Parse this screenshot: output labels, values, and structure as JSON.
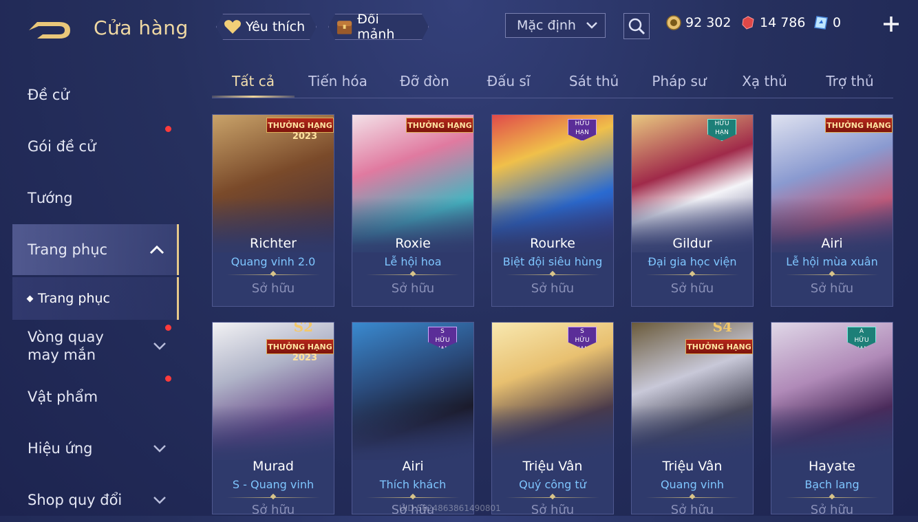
{
  "header": {
    "title": "Cửa hàng",
    "favorite_label": "Yêu thích",
    "shard_label": "Đổi mảnh",
    "sort_selected": "Mặc định",
    "currency": {
      "gold": "92 302",
      "ruby": "14 786",
      "voucher": "0"
    }
  },
  "sidebar": {
    "items": [
      {
        "label": "Đề cử"
      },
      {
        "label": "Gói đề cử"
      },
      {
        "label": "Tướng"
      },
      {
        "label": "Trang phục"
      },
      {
        "label": "Trang phục"
      },
      {
        "label": "Vòng quay may mắn"
      },
      {
        "label": "Vật phẩm"
      },
      {
        "label": "Hiệu ứng"
      },
      {
        "label": "Shop quy đổi"
      }
    ]
  },
  "tabs": [
    "Tất cả",
    "Tiến hóa",
    "Đỡ đòn",
    "Đấu sĩ",
    "Sát thủ",
    "Pháp sư",
    "Xạ thủ",
    "Trợ thủ"
  ],
  "cards": [
    {
      "hero": "Richter",
      "skin": "Quang vinh 2.0",
      "status": "Sở hữu",
      "badge": "THƯỞNG HẠNG",
      "year": "2023"
    },
    {
      "hero": "Roxie",
      "skin": "Lễ hội hoa",
      "status": "Sở hữu",
      "badge": "THƯỞNG HẠNG"
    },
    {
      "hero": "Rourke",
      "skin": "Biệt đội siêu hùng",
      "status": "Sở hữu",
      "badge": "HỮU HẠN"
    },
    {
      "hero": "Gildur",
      "skin": "Đại gia học viện",
      "status": "Sở hữu",
      "badge": "HỮU HẠN"
    },
    {
      "hero": "Airi",
      "skin": "Lễ hội mùa xuân",
      "status": "Sở hữu",
      "badge": "THƯỞNG HẠNG"
    },
    {
      "hero": "Murad",
      "skin": "S - Quang vinh",
      "status": "Sở hữu",
      "badge": "THƯỞNG HẠNG",
      "season": "S2",
      "year": "2023"
    },
    {
      "hero": "Airi",
      "skin": "Thích khách",
      "status": "Sở hữu",
      "badge": "HỮU HẠN",
      "tier": "S"
    },
    {
      "hero": "Triệu Vân",
      "skin": "Quý công tử",
      "status": "Sở hữu",
      "badge": "HỮU HẠN",
      "tier": "S"
    },
    {
      "hero": "Triệu Vân",
      "skin": "Quang vinh",
      "status": "Sở hữu",
      "badge": "THƯỞNG HẠNG",
      "season": "S4"
    },
    {
      "hero": "Hayate",
      "skin": "Bạch lang",
      "status": "Sở hữu",
      "badge": "HỮU HẠN",
      "tier": "A"
    }
  ],
  "watermark": "UID:5624863861490801",
  "colors": {
    "accent_gold": "#f0d59a",
    "skin_name_blue": "#7fc6ff",
    "notification_red": "#ff3b3b"
  }
}
